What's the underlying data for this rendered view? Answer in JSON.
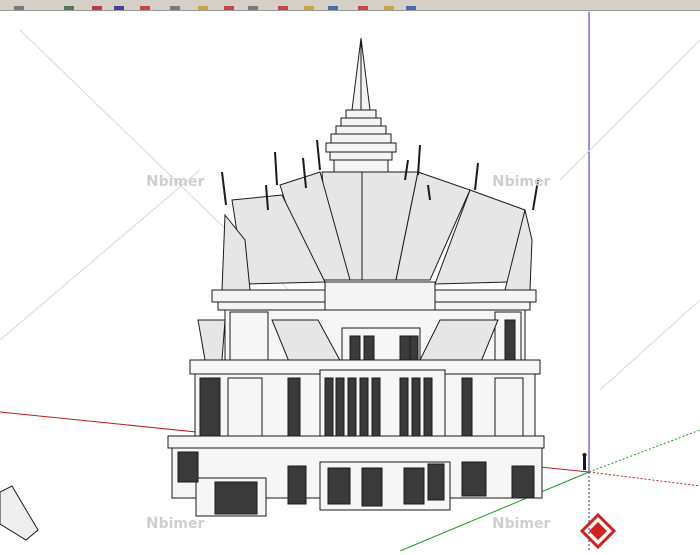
{
  "toolbar": {
    "tools": [
      {
        "icon": "select-icon",
        "color": "#6a6a6a"
      },
      {
        "icon": "make-component-icon",
        "color": "#3a6a3a"
      },
      {
        "icon": "eraser-icon",
        "color": "#b02030"
      },
      {
        "icon": "rectangle-icon",
        "color": "#2a2a8a"
      },
      {
        "icon": "line-icon",
        "color": "#c03030"
      },
      {
        "icon": "circle-icon",
        "color": "#6a6a6a"
      },
      {
        "icon": "push-pull-icon",
        "color": "#c0a020"
      },
      {
        "icon": "move-icon",
        "color": "#c03030"
      },
      {
        "icon": "rotate-icon",
        "color": "#6a6a6a"
      },
      {
        "icon": "offset-icon",
        "color": "#c03030"
      },
      {
        "icon": "tape-measure-icon",
        "color": "#c0a020"
      },
      {
        "icon": "paint-bucket-icon",
        "color": "#2a5ab0"
      },
      {
        "icon": "orbit-icon",
        "color": "#c03030"
      },
      {
        "icon": "pan-icon",
        "color": "#c0a020"
      },
      {
        "icon": "zoom-icon",
        "color": "#2a5ab0"
      }
    ]
  },
  "watermarks": [
    {
      "text": "bimer",
      "mark": "N"
    },
    {
      "text": "bimer",
      "mark": "N"
    },
    {
      "text": "bimer",
      "mark": "N"
    },
    {
      "text": "bimer",
      "mark": "N"
    }
  ],
  "colors": {
    "axis_red": "#c41a1a",
    "axis_green": "#1a9a1a",
    "axis_blue": "#2a2ad0",
    "ink": "#1a1a1a",
    "roof": "#e4e4e4",
    "wall": "#f2f2f2",
    "window": "#3a3a3a"
  }
}
